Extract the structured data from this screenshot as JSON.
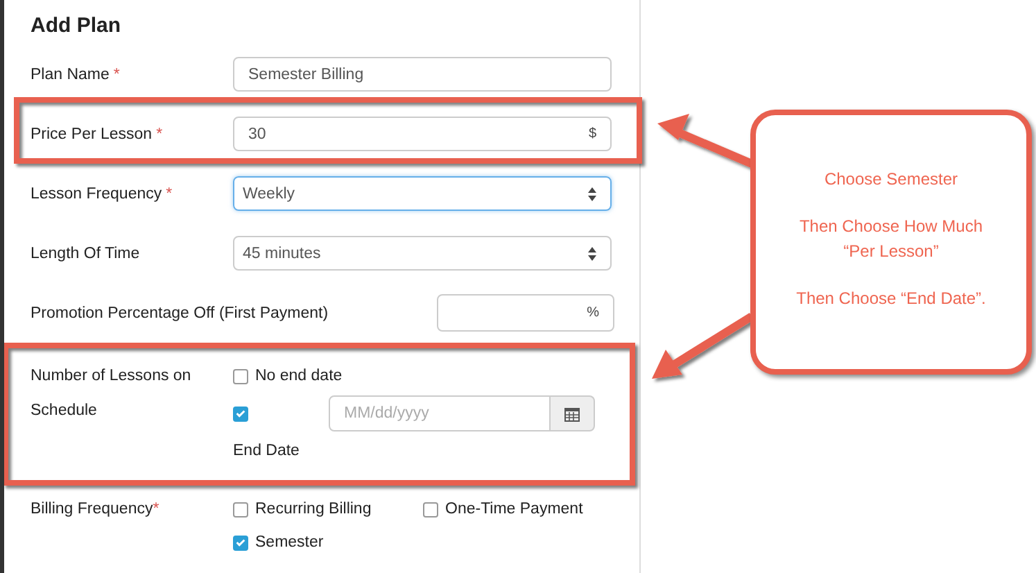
{
  "title": "Add Plan",
  "fields": [
    {
      "kind": "text",
      "label": "Plan Name",
      "required_mark": "*",
      "value": "Semester Billing"
    },
    {
      "kind": "addon",
      "label": "Price Per Lesson",
      "required_mark": "*",
      "value": "30",
      "addon": "$"
    },
    {
      "kind": "select",
      "label": "Lesson Frequency",
      "required_mark": "*",
      "value": "Weekly",
      "focused": true
    },
    {
      "kind": "select",
      "label": "Length Of Time",
      "value": "45 minutes",
      "focused": false
    },
    {
      "kind": "short",
      "label": "Promotion Percentage Off (First Payment)",
      "addon": "%"
    }
  ],
  "schedule": {
    "label_lines": [
      "Number of Lessons on",
      "Schedule"
    ],
    "no_end_date": {
      "label": "No end date",
      "checked": false
    },
    "end_date": {
      "checked": true,
      "placeholder": "MM/dd/yyyy",
      "label": "End Date"
    }
  },
  "billing": {
    "label": "Billing Frequency",
    "required_mark": "*",
    "options": [
      {
        "label": "Recurring Billing",
        "checked": false
      },
      {
        "label": "One-Time Payment",
        "checked": false
      },
      {
        "label": "Semester",
        "checked": true
      }
    ]
  },
  "callout": {
    "paragraphs": [
      "Choose Semester",
      "Then Choose How Much\n“Per Lesson”",
      "Then Choose “End Date”."
    ]
  }
}
